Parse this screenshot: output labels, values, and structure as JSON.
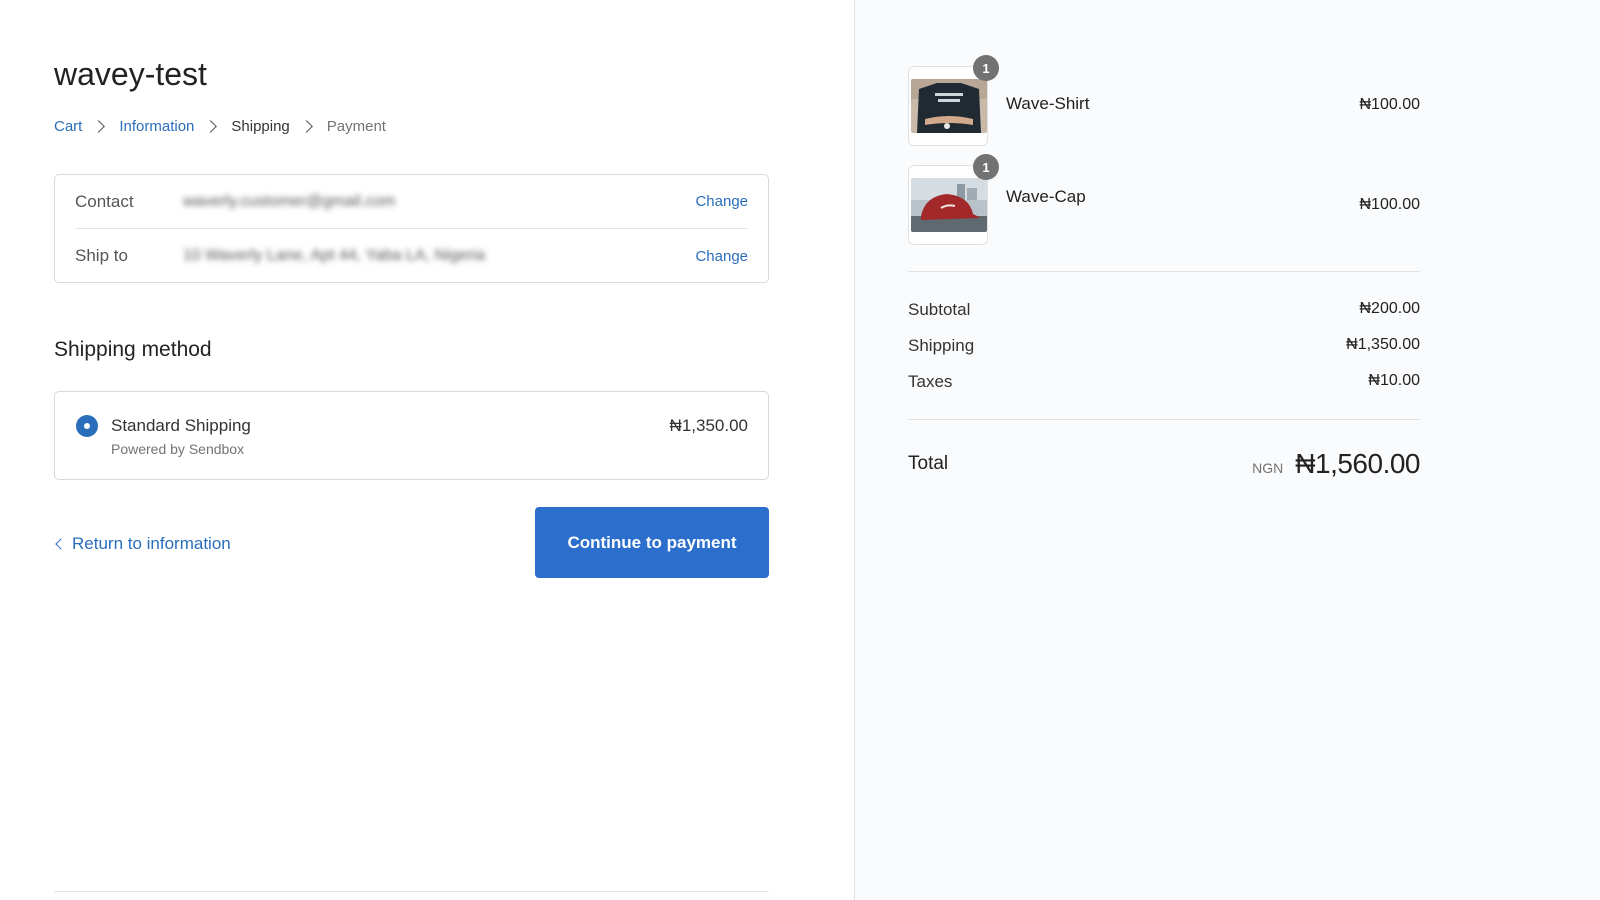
{
  "shop": {
    "title": "wavey-test"
  },
  "breadcrumb": {
    "cart": "Cart",
    "information": "Information",
    "shipping": "Shipping",
    "payment": "Payment"
  },
  "review": {
    "contact_label": "Contact",
    "contact_value": "waverly.customer@gmail.com",
    "ship_to_label": "Ship to",
    "ship_to_value": "10 Waverly Lane, Apt 44, Yaba LA, Nigeria",
    "change_label": "Change"
  },
  "shipping_method": {
    "title": "Shipping method",
    "option_name": "Standard Shipping",
    "option_sub": "Powered by Sendbox",
    "option_price": "₦1,350.00",
    "selected": true
  },
  "actions": {
    "return_label": "Return to information",
    "continue_label": "Continue to payment"
  },
  "order": {
    "items": [
      {
        "name": "Wave-Shirt",
        "price": "₦100.00",
        "quantity": "1",
        "image": "tshirt-photo"
      },
      {
        "name": "Wave-Cap",
        "price": "₦100.00",
        "quantity": "1",
        "image": "cap-photo"
      }
    ],
    "subtotal_label": "Subtotal",
    "subtotal_value": "₦200.00",
    "shipping_label": "Shipping",
    "shipping_value": "₦1,350.00",
    "taxes_label": "Taxes",
    "taxes_value": "₦10.00",
    "total_label": "Total",
    "currency": "NGN",
    "total_value": "₦1,560.00"
  },
  "colors": {
    "accent": "#2c6ecb",
    "link": "#2a6ebb",
    "sidebar_bg": "#fafbfd"
  }
}
